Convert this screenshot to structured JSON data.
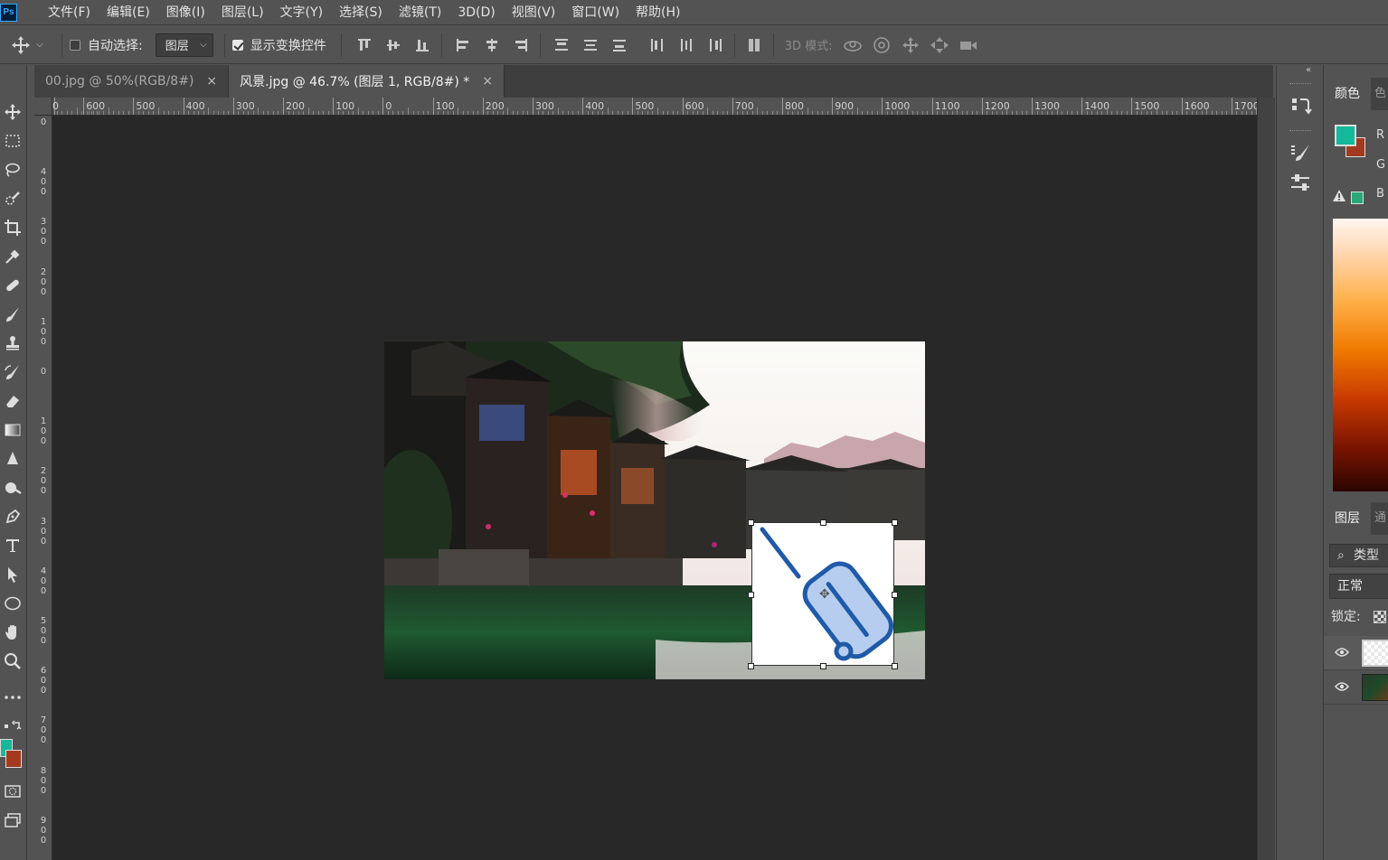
{
  "app": {
    "logo": "Ps"
  },
  "menu": [
    "文件(F)",
    "编辑(E)",
    "图像(I)",
    "图层(L)",
    "文字(Y)",
    "选择(S)",
    "滤镜(T)",
    "3D(D)",
    "视图(V)",
    "窗口(W)",
    "帮助(H)"
  ],
  "options": {
    "auto_select_label": "自动选择:",
    "auto_select_checked": false,
    "auto_select_target": "图层",
    "show_transform_label": "显示变换控件",
    "show_transform_checked": true,
    "mode_3d_label": "3D 模式:"
  },
  "tabs": [
    {
      "label": "00.jpg @ 50%(RGB/8#)",
      "active": false,
      "close": "×"
    },
    {
      "label": "风景.jpg @ 46.7% (图层 1, RGB/8#) *",
      "active": true,
      "close": "×"
    }
  ],
  "ruler_top": {
    "labels": [
      "0",
      "600",
      "500",
      "400",
      "300",
      "200",
      "100",
      "0",
      "100",
      "200",
      "300",
      "400",
      "500",
      "600",
      "700",
      "800",
      "900",
      "1000",
      "1100",
      "1200",
      "1300",
      "1400",
      "1500",
      "1600",
      "1700"
    ]
  },
  "ruler_left": {
    "labels": [
      "0",
      "400",
      "300",
      "200",
      "100",
      "0",
      "100",
      "200",
      "300",
      "400",
      "500",
      "600",
      "700",
      "800",
      "900",
      "1"
    ]
  },
  "colors": {
    "foreground": "#14b89a",
    "background": "#a33a20",
    "accent_icon": "#1f5aa8",
    "icon_fill": "#b6cdef"
  },
  "color_panel": {
    "tab_label": "颜色",
    "tab2_label": "色",
    "r_label": "R",
    "g_label": "G",
    "b_label": "B"
  },
  "layers_panel": {
    "tab_label": "图层",
    "tab2_label": "通",
    "search_label": "类型",
    "blend_mode": "正常",
    "lock_label": "锁定:",
    "layers": [
      {
        "thumb": "transparent",
        "visible": true,
        "selected": true
      },
      {
        "thumb": "photo",
        "visible": true,
        "selected": false
      }
    ]
  },
  "icons": {
    "move": "move-icon",
    "luggage": "luggage-icon"
  }
}
